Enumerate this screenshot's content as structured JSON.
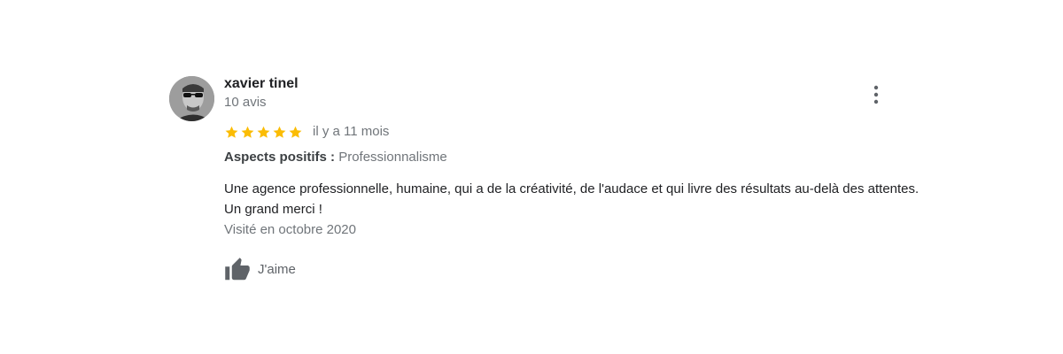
{
  "review": {
    "author_name": "xavier tinel",
    "author_review_count": "10 avis",
    "rating": 5,
    "rating_max": 5,
    "star_color": "#fbbc04",
    "date": "il y a 11 mois",
    "aspects_label": "Aspects positifs :",
    "aspects_value": "Professionnalisme",
    "text": "Une agence professionnelle, humaine, qui a de la créativité, de l'audace et qui livre des résultats au-delà des attentes. Un grand merci !",
    "visited": "Visité en octobre 2020",
    "like_label": "J'aime",
    "like_icon": "thumbs-up-icon",
    "menu_icon": "more-vert-icon"
  }
}
